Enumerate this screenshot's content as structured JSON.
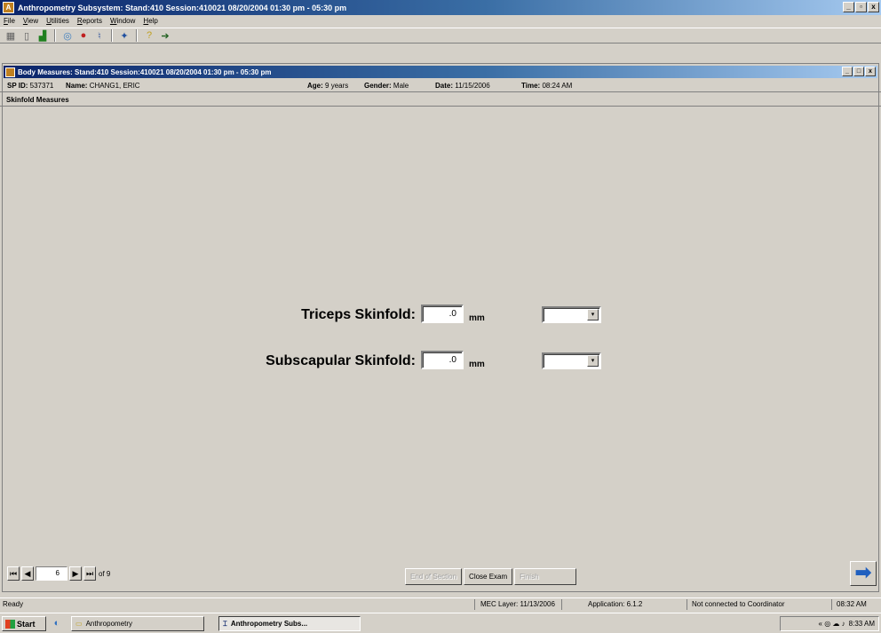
{
  "app": {
    "title": "Anthropometry Subsystem: Stand:410 Session:410021 08/20/2004 01:30 pm - 05:30 pm",
    "menu": [
      "File",
      "View",
      "Utilities",
      "Reports",
      "Window",
      "Help"
    ]
  },
  "child_window": {
    "title": "Body Measures: Stand:410 Session:410021 08/20/2004 01:30 pm - 05:30 pm"
  },
  "participant": {
    "sp_id_label": "SP ID:",
    "sp_id": "537371",
    "name_label": "Name:",
    "name": "CHANG1, ERIC",
    "age_label": "Age:",
    "age": "9 years",
    "gender_label": "Gender:",
    "gender": "Male",
    "date_label": "Date:",
    "date": "11/15/2006",
    "time_label": "Time:",
    "time": "08:24 AM"
  },
  "section": {
    "title": "Skinfold Measures"
  },
  "fields": {
    "triceps": {
      "label": "Triceps Skinfold:",
      "value": ".0",
      "unit": "mm",
      "select": ""
    },
    "subscapular": {
      "label": "Subscapular Skinfold:",
      "value": ".0",
      "unit": "mm",
      "select": ""
    }
  },
  "navigation": {
    "current": "6",
    "of": "of 9"
  },
  "buttons": {
    "end_of_section": "End of Section",
    "close_exam": "Close Exam",
    "finish": "Finish"
  },
  "status": {
    "ready": "Ready",
    "mec_layer": "MEC Layer: 11/13/2006",
    "application": "Application: 6.1.2",
    "connection": "Not connected to Coordinator",
    "time": "08:32 AM"
  },
  "taskbar": {
    "start": "Start",
    "task1": "Anthropometry",
    "task2": "Anthropometry Subs...",
    "clock": "8:33 AM"
  }
}
